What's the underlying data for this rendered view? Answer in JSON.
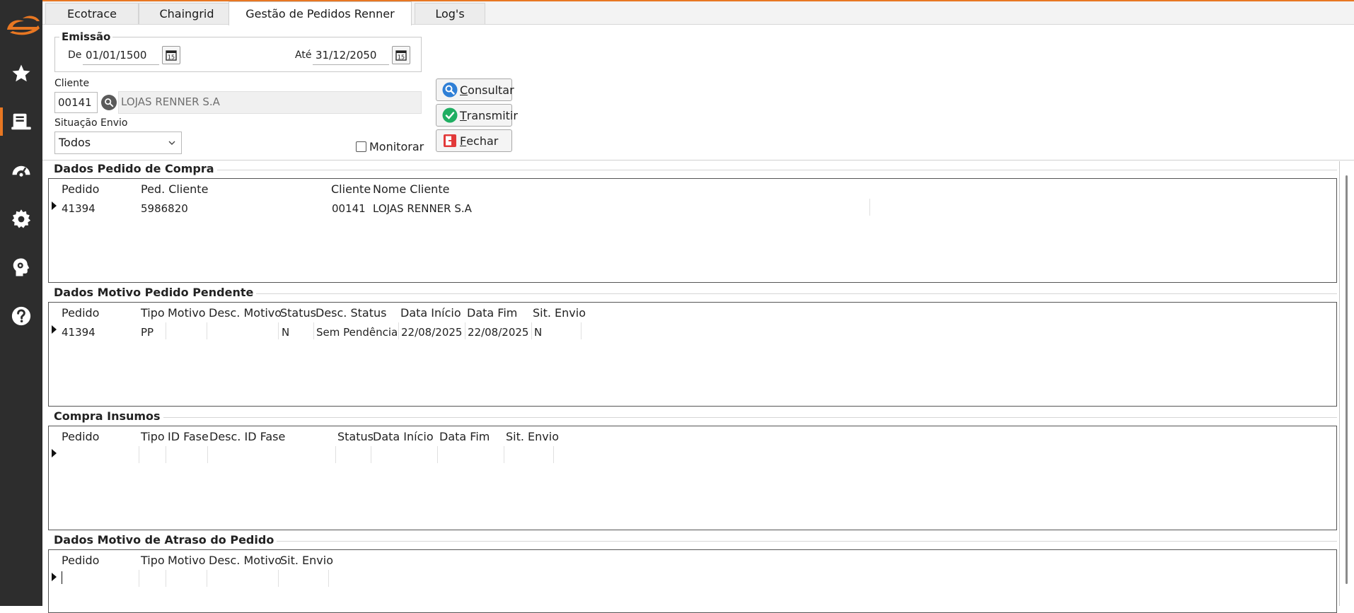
{
  "colors": {
    "accent": "#e87722",
    "sidebar_bg": "#2d2d2d"
  },
  "sidebar": {
    "items": [
      {
        "icon": "star-icon"
      },
      {
        "icon": "orders-icon",
        "active": true
      },
      {
        "icon": "speedometer-icon"
      },
      {
        "icon": "gear-icon"
      },
      {
        "icon": "head-gear-icon"
      },
      {
        "icon": "help-icon"
      }
    ]
  },
  "tabs": [
    {
      "label": "Ecotrace"
    },
    {
      "label": "Chaingrid"
    },
    {
      "label": "Gestão de Pedidos Renner",
      "active": true
    },
    {
      "label": "Log's"
    }
  ],
  "filters": {
    "emissao_label": "Emissão",
    "de_label": "De",
    "de_value": "01/01/1500",
    "ate_label": "Até",
    "ate_value": "31/12/2050",
    "cliente_label": "Cliente",
    "cliente_code": "00141",
    "cliente_name": "LOJAS RENNER S.A",
    "situacao_label": "Situação Envio",
    "situacao_value": "Todos",
    "monitorar_label": "Monitorar",
    "monitorar_checked": false
  },
  "buttons": {
    "consultar_first": "C",
    "consultar_rest": "onsultar",
    "transmitir_first": "T",
    "transmitir_rest": "ransmitir",
    "fechar_first": "F",
    "fechar_rest": "echar"
  },
  "grids": {
    "pedido_compra": {
      "title": "Dados Pedido de Compra",
      "columns": [
        "Pedido",
        "Ped. Cliente",
        "Cliente",
        "Nome Cliente"
      ],
      "rows": [
        [
          "41394",
          "5986820",
          "00141",
          "LOJAS RENNER S.A"
        ]
      ]
    },
    "motivo_pendente": {
      "title": "Dados Motivo Pedido Pendente",
      "columns": [
        "Pedido",
        "Tipo",
        "Motivo",
        "Desc. Motivo",
        "Status",
        "Desc. Status",
        "Data Início",
        "Data Fim",
        "Sit. Envio"
      ],
      "rows": [
        [
          "41394",
          "PP",
          "",
          "",
          "N",
          "Sem Pendência",
          "22/08/2025",
          "22/08/2025",
          "N"
        ]
      ]
    },
    "compra_insumos": {
      "title": "Compra Insumos",
      "columns": [
        "Pedido",
        "Tipo",
        "ID Fase",
        "Desc. ID Fase",
        "Status",
        "Data Início",
        "Data Fim",
        "Sit. Envio"
      ],
      "rows": []
    },
    "motivo_atraso": {
      "title": "Dados Motivo de Atraso do Pedido",
      "columns": [
        "Pedido",
        "Tipo",
        "Motivo",
        "Desc. Motivo",
        "Sit. Envio"
      ],
      "rows": []
    }
  }
}
